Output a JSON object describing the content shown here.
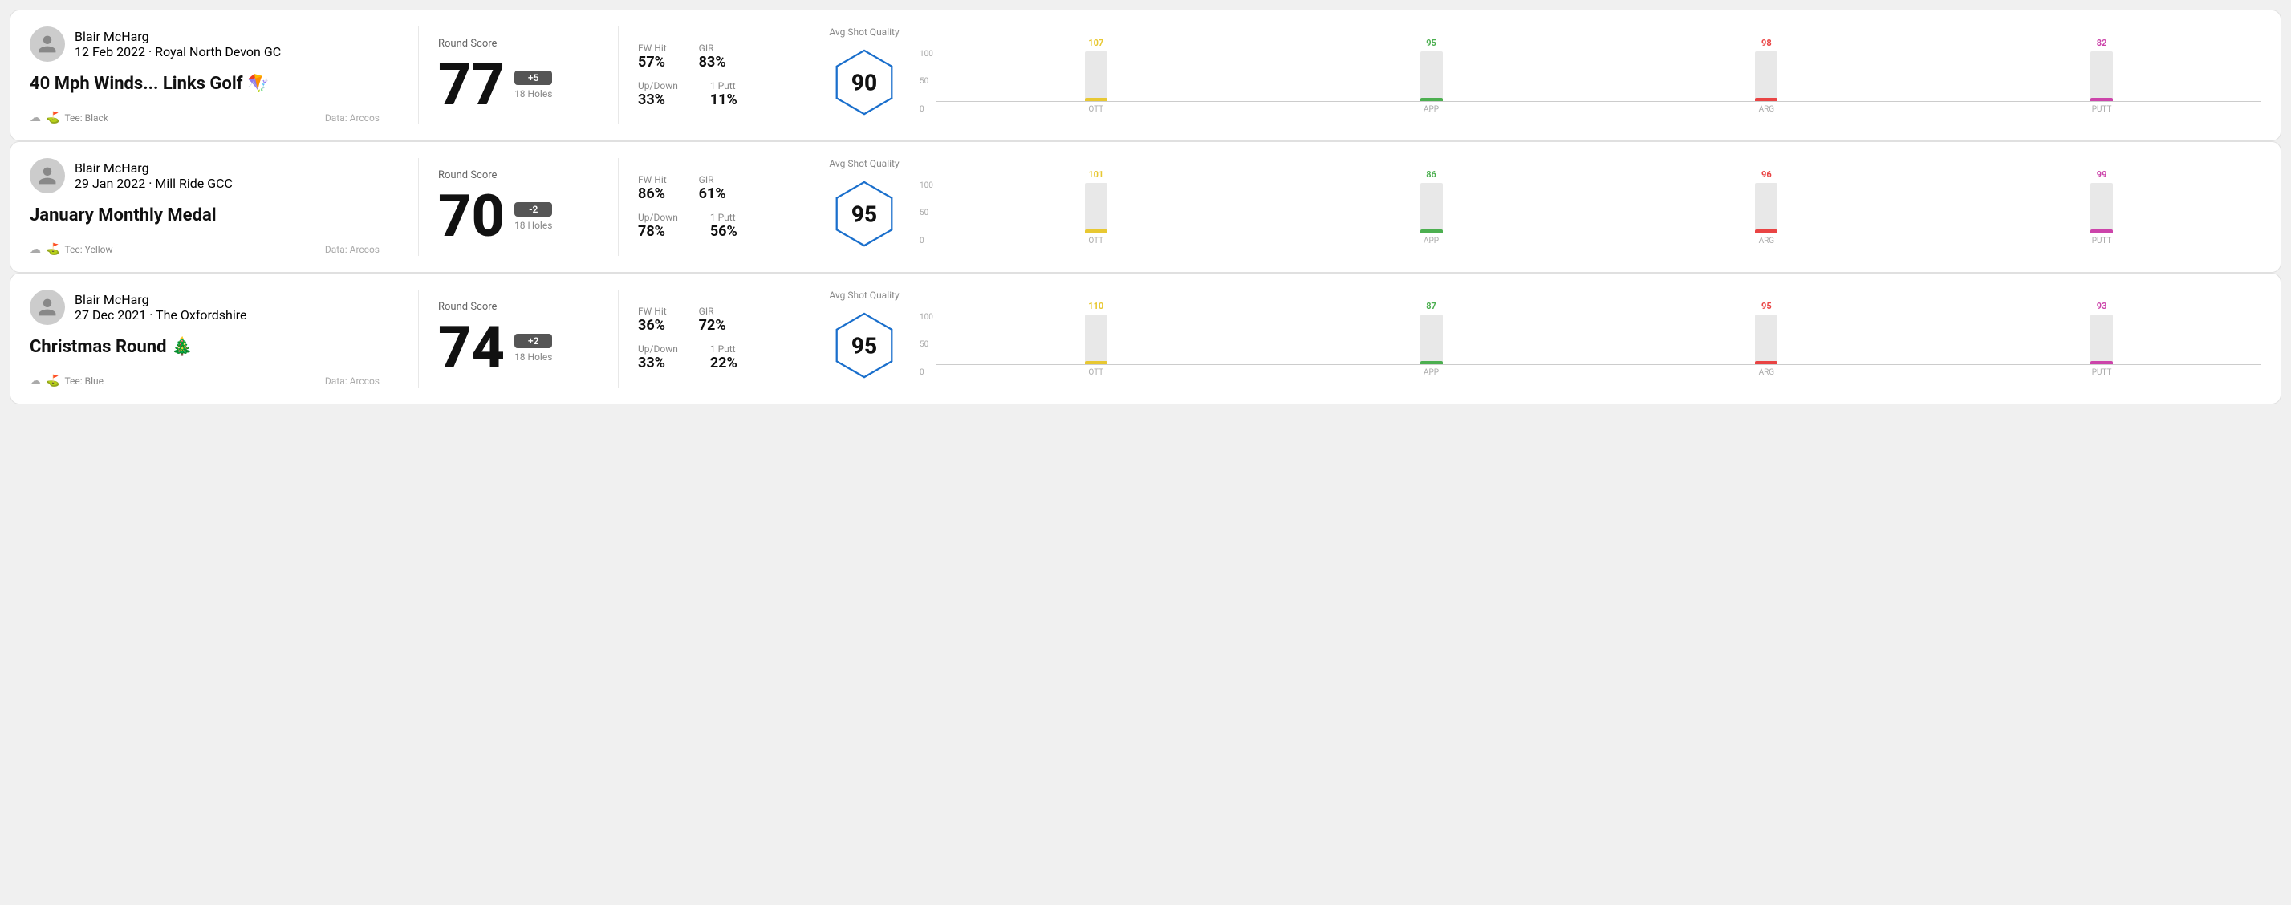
{
  "rounds": [
    {
      "id": "round-1",
      "player": {
        "name": "Blair McHarg",
        "date": "12 Feb 2022",
        "course": "Royal North Devon GC",
        "tee": "Black",
        "data_source": "Data: Arccos"
      },
      "title": "40 Mph Winds... Links Golf 🪁",
      "score": {
        "label": "Round Score",
        "number": "77",
        "modifier": "+5",
        "holes": "18 Holes"
      },
      "stats": {
        "fw_hit_label": "FW Hit",
        "fw_hit": "57%",
        "gir_label": "GIR",
        "gir": "83%",
        "updown_label": "Up/Down",
        "updown": "33%",
        "oneputt_label": "1 Putt",
        "oneputt": "11%"
      },
      "quality": {
        "label": "Avg Shot Quality",
        "score": "90",
        "hex_color": "#1a6fcc"
      },
      "bars": [
        {
          "label": "OTT",
          "value": 107,
          "max": 120,
          "color": "#e8c832"
        },
        {
          "label": "APP",
          "value": 95,
          "max": 120,
          "color": "#4caf50"
        },
        {
          "label": "ARG",
          "value": 98,
          "max": 120,
          "color": "#e94444"
        },
        {
          "label": "PUTT",
          "value": 82,
          "max": 120,
          "color": "#cc44aa"
        }
      ]
    },
    {
      "id": "round-2",
      "player": {
        "name": "Blair McHarg",
        "date": "29 Jan 2022",
        "course": "Mill Ride GCC",
        "tee": "Yellow",
        "data_source": "Data: Arccos"
      },
      "title": "January Monthly Medal",
      "score": {
        "label": "Round Score",
        "number": "70",
        "modifier": "-2",
        "holes": "18 Holes"
      },
      "stats": {
        "fw_hit_label": "FW Hit",
        "fw_hit": "86%",
        "gir_label": "GIR",
        "gir": "61%",
        "updown_label": "Up/Down",
        "updown": "78%",
        "oneputt_label": "1 Putt",
        "oneputt": "56%"
      },
      "quality": {
        "label": "Avg Shot Quality",
        "score": "95",
        "hex_color": "#1a6fcc"
      },
      "bars": [
        {
          "label": "OTT",
          "value": 101,
          "max": 120,
          "color": "#e8c832"
        },
        {
          "label": "APP",
          "value": 86,
          "max": 120,
          "color": "#4caf50"
        },
        {
          "label": "ARG",
          "value": 96,
          "max": 120,
          "color": "#e94444"
        },
        {
          "label": "PUTT",
          "value": 99,
          "max": 120,
          "color": "#cc44aa"
        }
      ]
    },
    {
      "id": "round-3",
      "player": {
        "name": "Blair McHarg",
        "date": "27 Dec 2021",
        "course": "The Oxfordshire",
        "tee": "Blue",
        "data_source": "Data: Arccos"
      },
      "title": "Christmas Round 🎄",
      "score": {
        "label": "Round Score",
        "number": "74",
        "modifier": "+2",
        "holes": "18 Holes"
      },
      "stats": {
        "fw_hit_label": "FW Hit",
        "fw_hit": "36%",
        "gir_label": "GIR",
        "gir": "72%",
        "updown_label": "Up/Down",
        "updown": "33%",
        "oneputt_label": "1 Putt",
        "oneputt": "22%"
      },
      "quality": {
        "label": "Avg Shot Quality",
        "score": "95",
        "hex_color": "#1a6fcc"
      },
      "bars": [
        {
          "label": "OTT",
          "value": 110,
          "max": 120,
          "color": "#e8c832"
        },
        {
          "label": "APP",
          "value": 87,
          "max": 120,
          "color": "#4caf50"
        },
        {
          "label": "ARG",
          "value": 95,
          "max": 120,
          "color": "#e94444"
        },
        {
          "label": "PUTT",
          "value": 93,
          "max": 120,
          "color": "#cc44aa"
        }
      ]
    }
  ],
  "y_axis": [
    "100",
    "50",
    "0"
  ]
}
